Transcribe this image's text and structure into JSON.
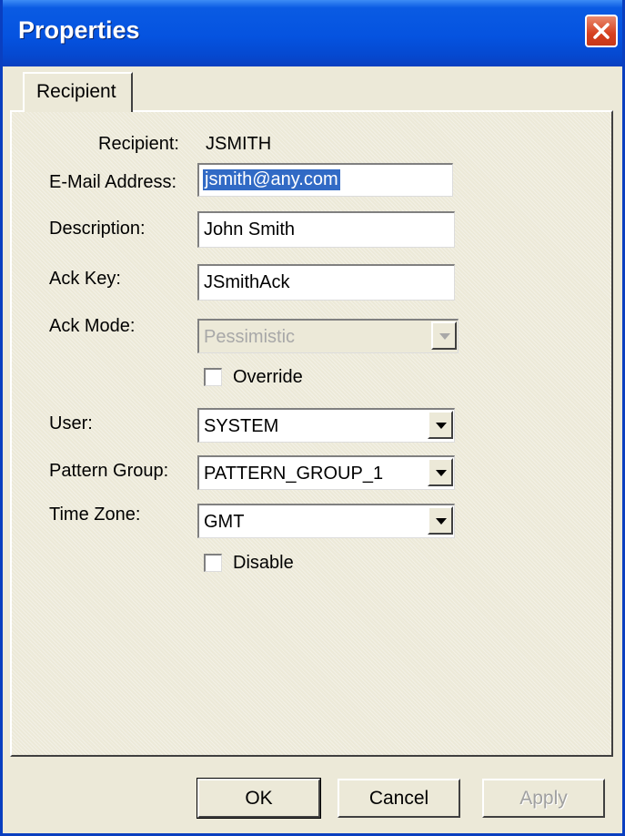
{
  "window": {
    "title": "Properties"
  },
  "tabs": [
    {
      "label": "Recipient"
    }
  ],
  "form": {
    "recipient": {
      "label": "Recipient:",
      "value": "JSMITH"
    },
    "email": {
      "label": "E-Mail Address:",
      "value": "jsmith@any.com"
    },
    "description": {
      "label": "Description:",
      "value": "John Smith"
    },
    "ack_key": {
      "label": "Ack Key:",
      "value": "JSmithAck"
    },
    "ack_mode": {
      "label": "Ack Mode:",
      "value": "Pessimistic",
      "disabled": true
    },
    "override": {
      "label": "Override",
      "checked": false
    },
    "user": {
      "label": "User:",
      "value": "SYSTEM"
    },
    "pattern_group": {
      "label": "Pattern Group:",
      "value": "PATTERN_GROUP_1"
    },
    "time_zone": {
      "label": "Time Zone:",
      "value": "GMT"
    },
    "disable": {
      "label": "Disable",
      "checked": false
    }
  },
  "buttons": {
    "ok": "OK",
    "cancel": "Cancel",
    "apply": "Apply"
  },
  "colors": {
    "title_bar": "#0553e0",
    "selection": "#316ac5",
    "dialog_bg": "#ece9d8",
    "close_button": "#d6401f"
  },
  "icons": {
    "close": "close-icon",
    "dropdown": "chevron-down-icon"
  }
}
